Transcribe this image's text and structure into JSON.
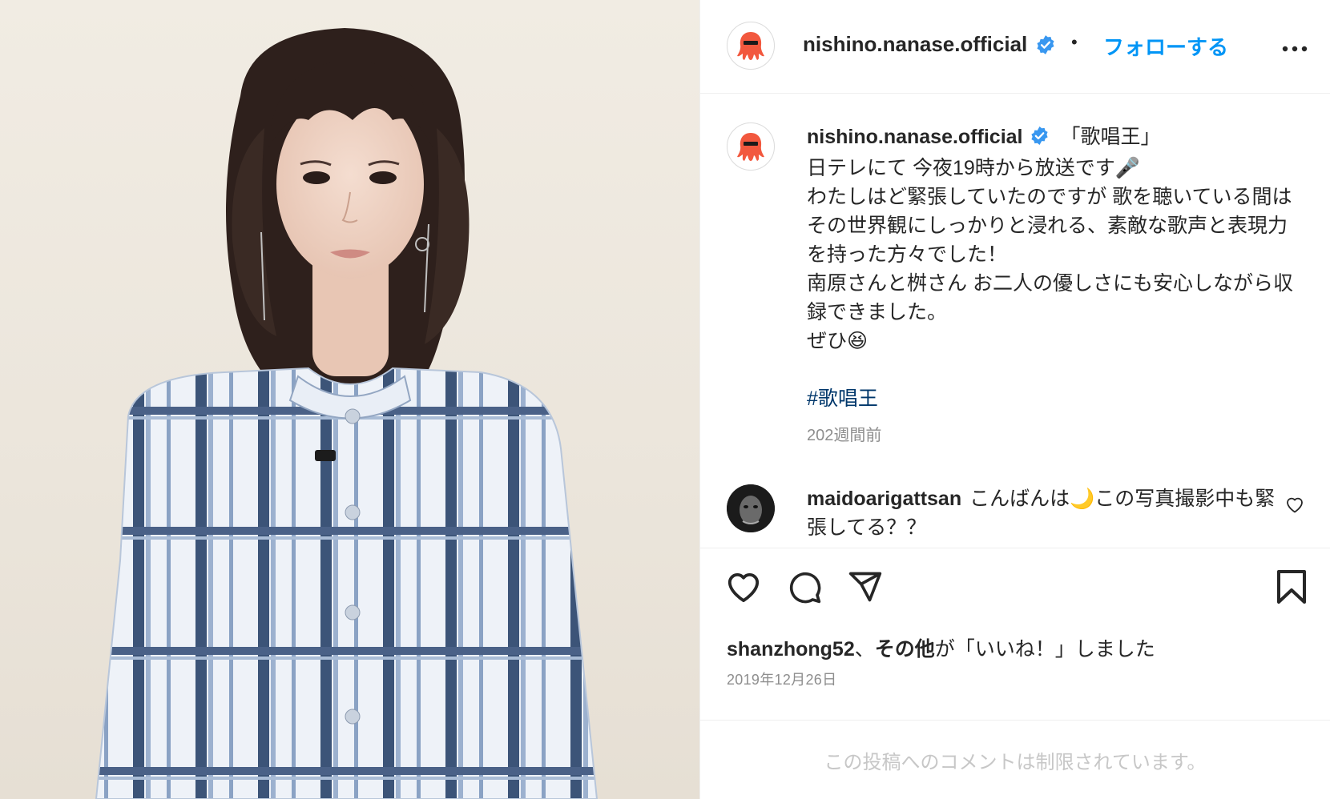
{
  "header": {
    "username": "nishino.nanase.official",
    "separator": "•",
    "follow_label": "フォローする"
  },
  "caption": {
    "username": "nishino.nanase.official",
    "text": "「歌唱王」\n日テレにて 今夜19時から放送です🎤\nわたしはど緊張していたのですが 歌を聴いている間はその世界観にしっかりと浸れる、素敵な歌声と表現力を持った方々でした！\n南原さんと桝さん お二人の優しさにも安心しながら収録できました。\nぜひ😆",
    "hashtag": "#歌唱王",
    "age": "202週間前"
  },
  "comment": {
    "username": "maidoarigattsan",
    "text": "こんばんは🌙この写真撮影中も緊張してる？？"
  },
  "likes": {
    "user": "shanzhong52",
    "separator": "、",
    "others": "その他",
    "suffix": "が「いいね！」しました"
  },
  "date": "2019年12月26日",
  "restricted_notice": "この投稿へのコメントは制限されています。",
  "icons": {
    "avatar": "red-octopus-icon",
    "verified": "verified-badge-icon",
    "more": "more-options-icon",
    "like": "heart-icon",
    "comment": "comment-icon",
    "share": "send-icon",
    "save": "bookmark-icon"
  },
  "colors": {
    "link": "#0095f6",
    "hashtag": "#00376b",
    "muted": "#8e8e8e",
    "verified": "#3897f0",
    "avatar_red": "#f2583e"
  }
}
